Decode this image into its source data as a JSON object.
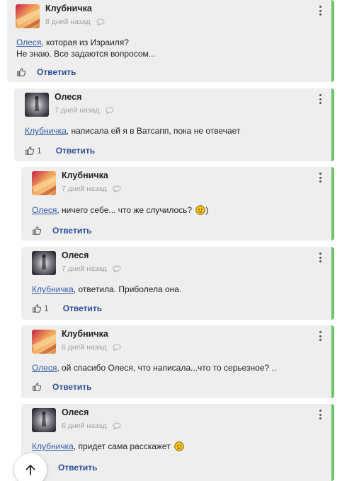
{
  "reply_label": "Ответить",
  "comments": [
    {
      "author": "Клубничка",
      "time": "8 дней назад",
      "mention": "Олеся",
      "text": ", которая из Израиля?",
      "text2": "Не знаю. Все задаются вопросом...",
      "likes": ""
    },
    {
      "author": "Олеся",
      "time": "7 дней назад",
      "mention": "Клубничка",
      "text": ", написала ей я в Ватсапп, пока не отвечает",
      "likes": "1"
    },
    {
      "author": "Клубничка",
      "time": "7 дней назад",
      "mention": "Олеся",
      "text": ", ничего себе... что же случилось?",
      "text_after": ")",
      "likes": ""
    },
    {
      "author": "Олеся",
      "time": "7 дней назад",
      "mention": "Клубничка",
      "text": ", ответила. Приболела она.",
      "likes": "1"
    },
    {
      "author": "Клубничка",
      "time": "6 дней назад",
      "mention": "Олеся",
      "text": ", ой спасибо Олеся, что написала...что то серьезное? ..",
      "likes": ""
    },
    {
      "author": "Олеся",
      "time": "6 дней назад",
      "mention": "Клубничка",
      "text": ", придет сама расскажет",
      "likes": ""
    }
  ],
  "colors": {
    "accent_border": "#6cc36a",
    "link": "#2f5aa8",
    "reply": "#2f4f9a"
  },
  "icons": [
    "like-icon",
    "reply-bubble-icon",
    "more-options-icon",
    "arrow-up-icon",
    "emoji-icon"
  ]
}
